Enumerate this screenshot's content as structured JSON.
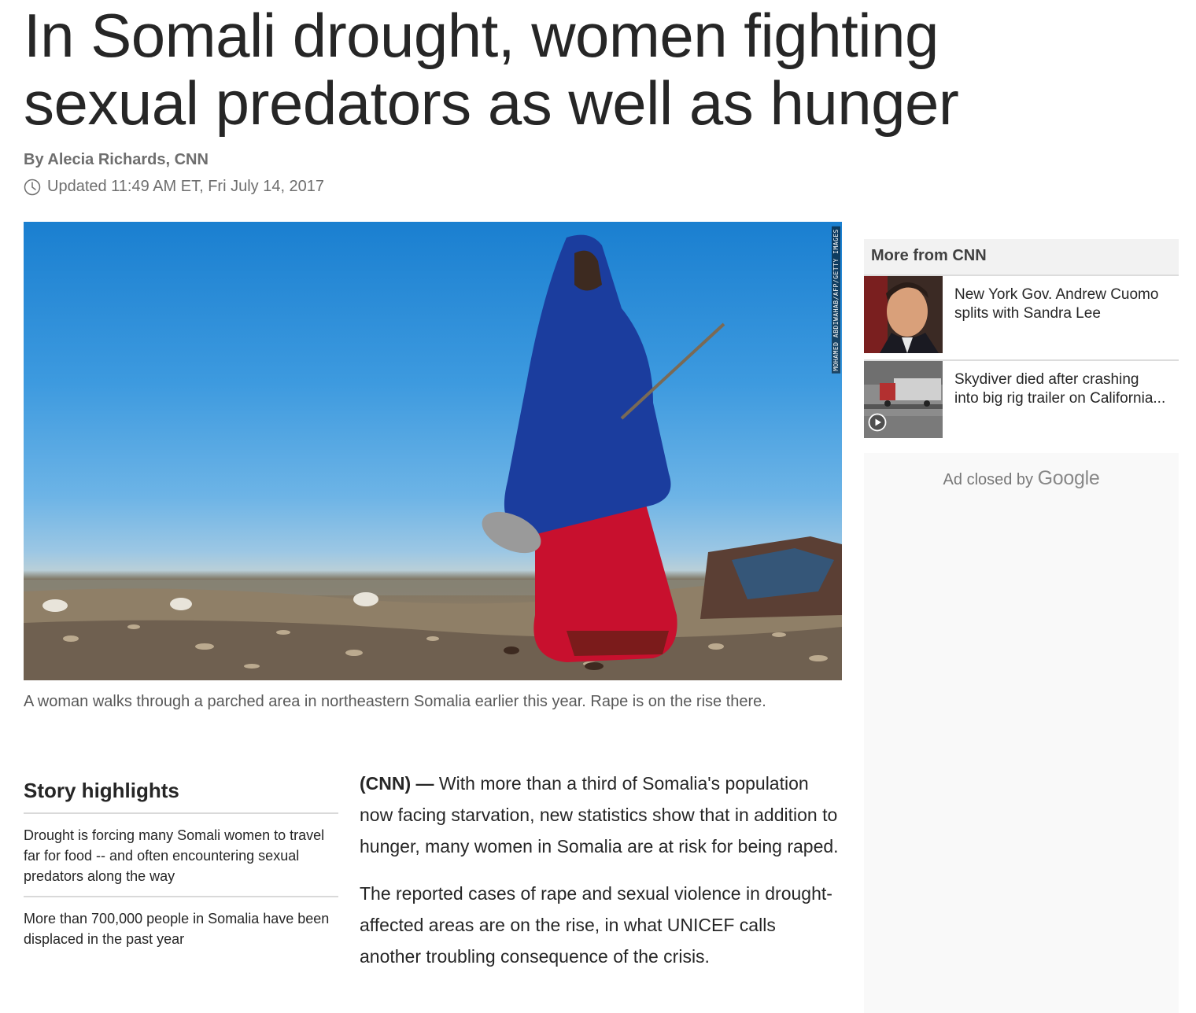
{
  "article": {
    "headline": "In Somali drought, women fighting sexual predators as well as hunger",
    "byline": "By Alecia Richards, CNN",
    "updated": "Updated 11:49 AM ET, Fri July 14, 2017",
    "photo_credit": "MOHAMED ABDIWAHAB/AFP/GETTY IMAGES",
    "caption": "A woman walks through a parched area in northeastern Somalia earlier this year. Rape is on the rise there."
  },
  "highlights": {
    "title": "Story highlights",
    "items": [
      "Drought is forcing many Somali women to travel far for food -- and often encountering sexual predators along the way",
      "More than 700,000 people in Somalia have been displaced in the past year"
    ]
  },
  "body": {
    "dateline": "(CNN) —",
    "paragraph1": " With more than a third of Somalia's population now facing starvation, new statistics show that in addition to hunger, many women in Somalia are at risk for being raped.",
    "paragraph2": "The reported cases of rape and sexual violence in drought-affected areas are on the rise, in what UNICEF calls another troubling consequence of the crisis."
  },
  "sidebar": {
    "title": "More from CNN",
    "items": [
      {
        "text": "New York Gov. Andrew Cuomo splits with Sandra Lee",
        "has_video": false
      },
      {
        "text": "Skydiver died after crashing into big rig trailer on California...",
        "has_video": true
      }
    ],
    "ad_label": "Ad closed by",
    "ad_brand": "Google"
  },
  "icons": {
    "clock": "clock-icon",
    "play": "play-icon"
  }
}
